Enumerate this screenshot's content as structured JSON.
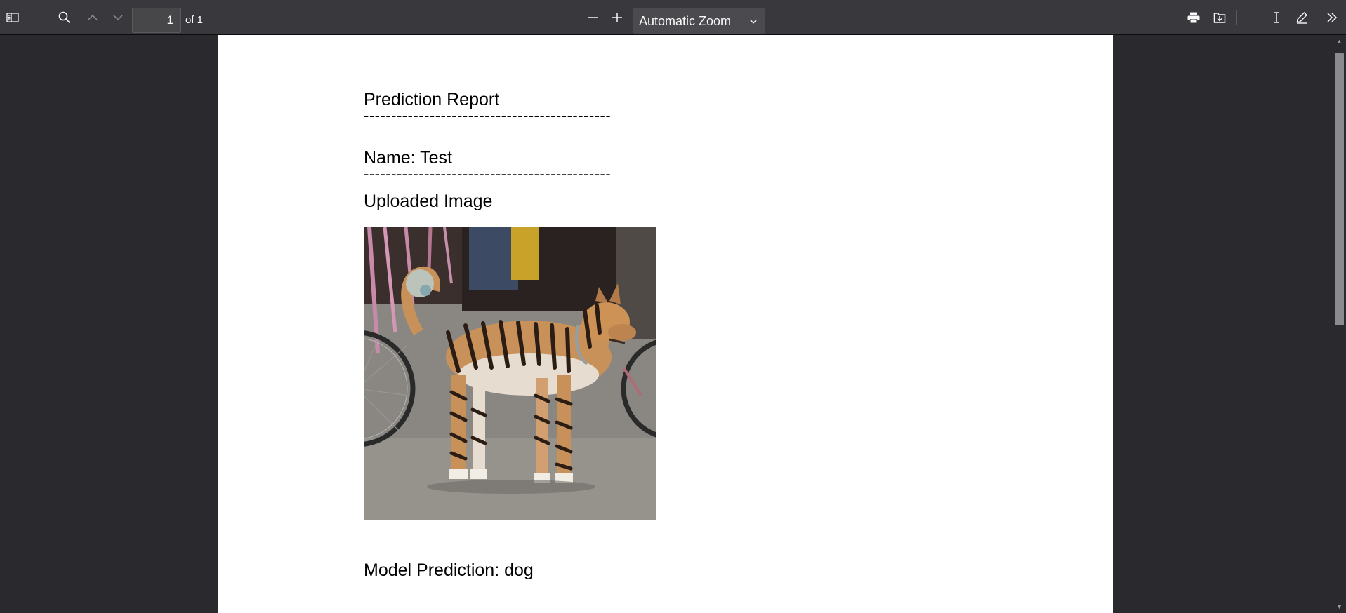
{
  "toolbar": {
    "page_number": "1",
    "page_count": "of 1",
    "zoom_label": "Automatic Zoom",
    "icons": [
      "sidebar-toggle-icon",
      "search-icon",
      "previous-page-icon",
      "next-page-icon",
      "zoom-out-icon",
      "zoom-in-icon",
      "chevron-down-icon",
      "print-icon",
      "save-icon",
      "text-cursor-icon",
      "draw-icon",
      "tools-icon"
    ]
  },
  "document": {
    "title": "Prediction Report",
    "separator": "---------------------------------------------",
    "name_line": "Name: Test",
    "uploaded_heading": "Uploaded Image",
    "prediction_line": "Model Prediction: dog"
  },
  "colors": {
    "toolbar_bg": "#38383d",
    "viewer_bg": "#2a2a2e",
    "page_bg": "#ffffff"
  }
}
